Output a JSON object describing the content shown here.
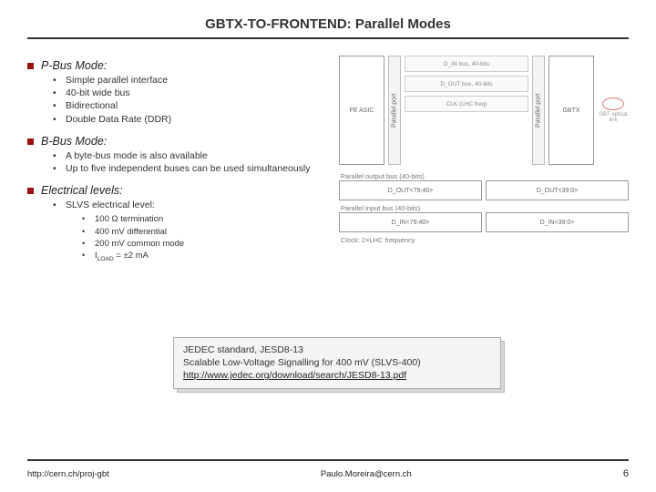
{
  "title": "GBTX-TO-FRONTEND: Parallel Modes",
  "sections": {
    "pbus": {
      "title": "P-Bus Mode:",
      "items": [
        "Simple parallel interface",
        "40-bit wide bus",
        "Bidirectional",
        "Double Data Rate (DDR)"
      ]
    },
    "bbus": {
      "title": "B-Bus Mode:",
      "items": [
        "A byte-bus mode is also available",
        "Up to five independent buses can be used simultaneously"
      ]
    },
    "elec": {
      "title": "Electrical levels:",
      "items": [
        "SLVS electrical level:"
      ],
      "sub": [
        "100 Ω termination",
        "400 mV differential",
        "200 mV common mode",
        "I_LOAD = ±2 mA"
      ]
    }
  },
  "diagram": {
    "top": {
      "left_block": "FE ASIC",
      "right_block": "GBTX",
      "left_port": "Parallel port",
      "right_port": "Parallel port",
      "wires": [
        "D_IN bus, 40-bits",
        "D_OUT bus, 40-bits",
        "CLK (LHC freq)"
      ],
      "ellipse": "GBT optical link"
    },
    "bottom": {
      "out_label": "Parallel output bus (40-bits)",
      "out_cells": [
        "D_OUT<79:40>",
        "D_OUT<39:0>"
      ],
      "in_label": "Parallel input bus (40-bits)",
      "in_cells": [
        "D_IN<79:40>",
        "D_IN<39:0>"
      ],
      "clock": "Clock: 2×LHC frequency"
    }
  },
  "jedec": {
    "line1": "JEDEC standard, JESD8-13",
    "line2": "Scalable Low-Voltage Signalling for 400 mV (SLVS-400)",
    "link": "http://www.jedec.org/download/search/JESD8-13.pdf"
  },
  "footer": {
    "left": "http://cern.ch/proj-gbt",
    "center": "Paulo.Moreira@cern.ch",
    "page": "6"
  }
}
